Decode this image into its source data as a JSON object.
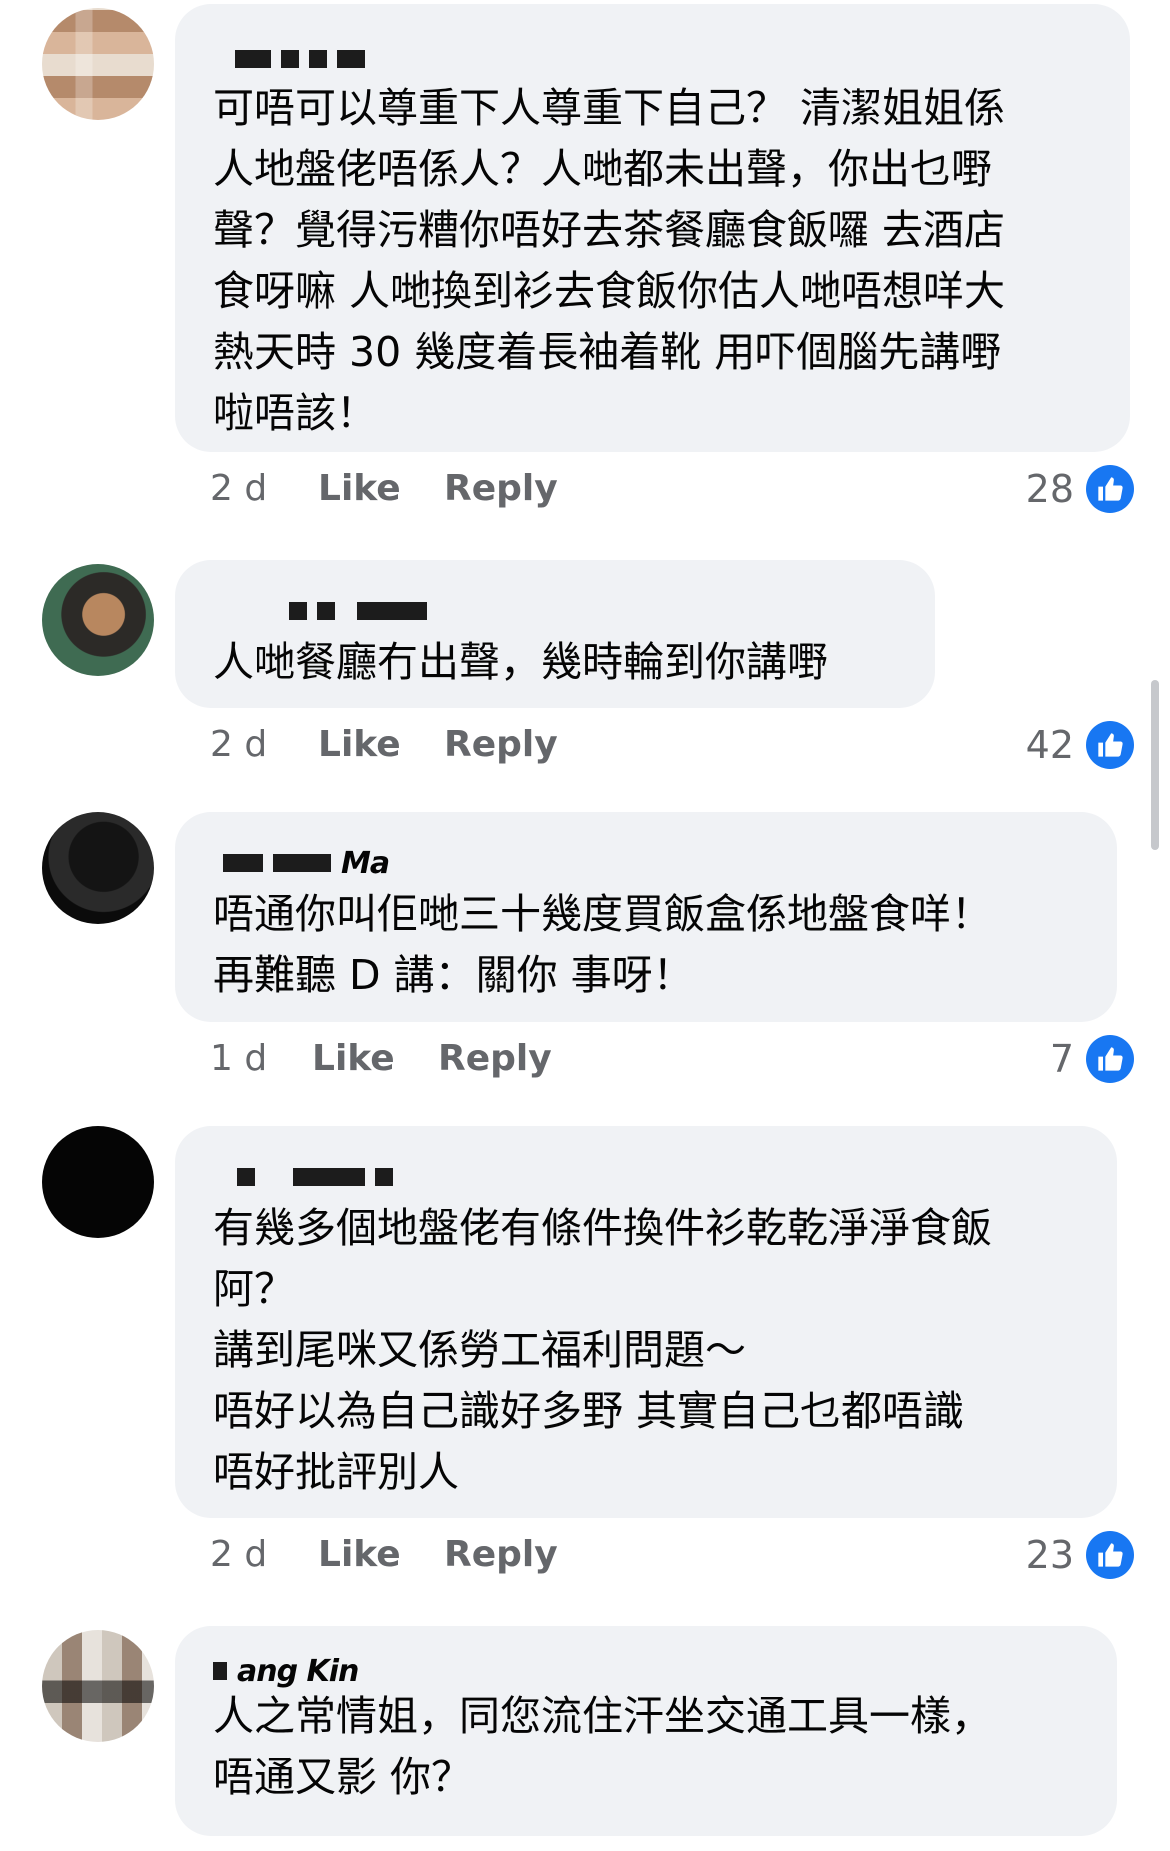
{
  "comments": [
    {
      "author": "",
      "text": "可唔可以尊重下人尊重下自己？ 清潔姐姐係\n人地盤佬唔係人？人哋都未出聲，你出乜嘢\n聲？覺得污糟你唔好去茶餐廳食飯囉 去酒店\n食呀嘛 人哋換到衫去食飯你估人哋唔想咩大\n熱天時 30 幾度着長袖着靴 用吓個腦先講嘢\n啦唔該！",
      "time": "2 d",
      "like_label": "Like",
      "reply_label": "Reply",
      "reactions": "28"
    },
    {
      "author": "",
      "text": "人哋餐廳冇出聲，幾時輪到你講嘢",
      "time": "2 d",
      "like_label": "Like",
      "reply_label": "Reply",
      "reactions": "42"
    },
    {
      "author": "Ma",
      "text": "唔通你叫佢哋三十幾度買飯盒係地盤食咩！\n再難聽 D 講：關你 事呀！",
      "time": "1 d",
      "like_label": "Like",
      "reply_label": "Reply",
      "reactions": "7"
    },
    {
      "author": "",
      "text": "有幾多個地盤佬有條件換件衫乾乾淨淨食飯\n阿？\n講到尾咪又係勞工福利問題～\n唔好以為自己識好多野 其實自己乜都唔識\n唔好批評別人",
      "time": "2 d",
      "like_label": "Like",
      "reply_label": "Reply",
      "reactions": "23"
    },
    {
      "author": "ang Kin",
      "text": "人之常情姐，同您流住汗坐交通工具一樣，\n唔通又影 你？",
      "time": "",
      "like_label": "",
      "reply_label": "",
      "reactions": ""
    }
  ],
  "icons": {
    "like": "thumbs-up-icon",
    "avatar": "avatar"
  },
  "colors": {
    "bubble": "#f0f2f5",
    "like_blue": "#1877f2",
    "meta_gray": "#65676b"
  }
}
